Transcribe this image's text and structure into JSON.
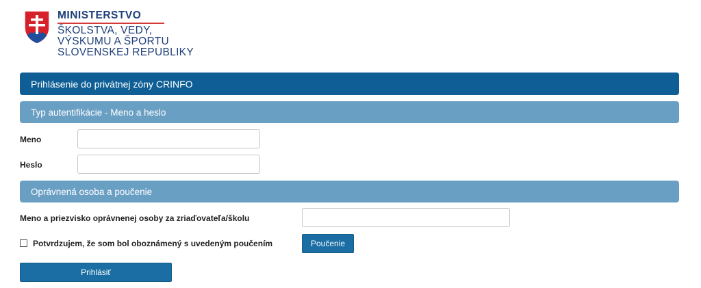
{
  "logo": {
    "line1": "MINISTERSTVO",
    "line2": "ŠKOLSTVA, VEDY,",
    "line3": "VÝSKUMU A ŠPORTU",
    "line4": "SLOVENSKEJ REPUBLIKY",
    "crest_icon": "slovak-coat-of-arms-icon"
  },
  "header": {
    "title": "Prihlásenie do privátnej zóny CRINFO"
  },
  "auth_section": {
    "title": "Typ autentifikácie - Meno a heslo",
    "username_label": "Meno",
    "username_value": "",
    "password_label": "Heslo",
    "password_value": ""
  },
  "consent_section": {
    "title": "Oprávnená osoba a poučenie",
    "person_label": "Meno a priezvisko oprávnenej osoby za zriaďovateľa/školu",
    "person_value": "",
    "confirm_label": "Potvrdzujem, že som bol oboznámený s uvedeným poučením",
    "confirm_checked": false,
    "info_button": "Poučenie"
  },
  "submit_button": "Prihlásiť",
  "colors": {
    "primary": "#0f5f96",
    "section": "#6a9fc4",
    "button": "#1b6ea3",
    "logo_text": "#1f3f7a",
    "logo_accent": "#d53a3a"
  }
}
